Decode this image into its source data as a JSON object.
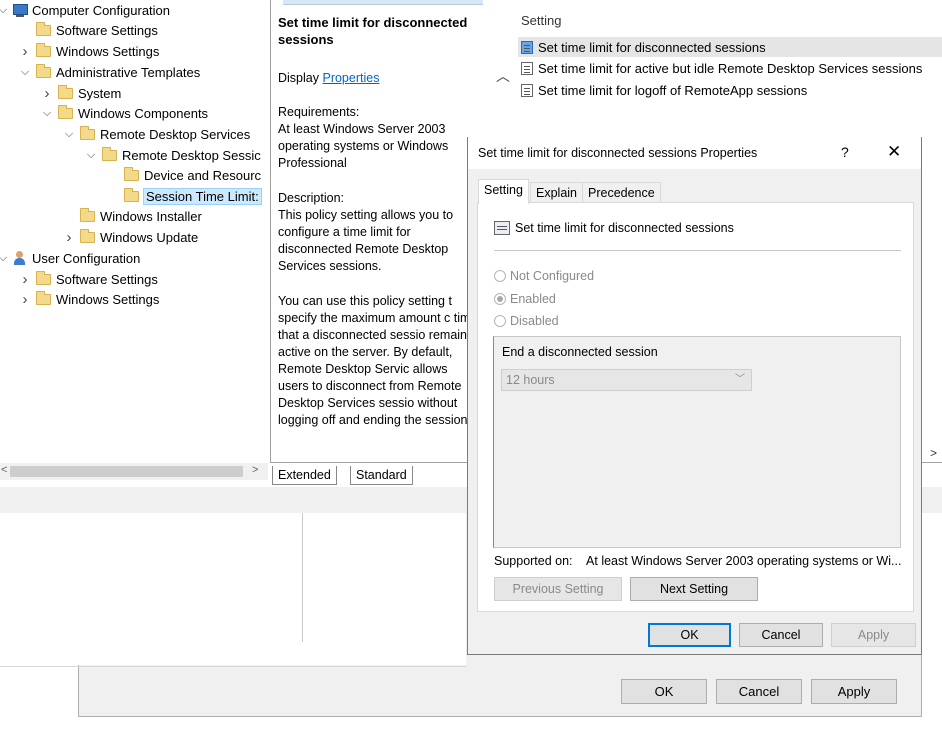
{
  "tree": {
    "items": [
      {
        "label": "Computer Configuration",
        "icon": "computer-icon",
        "chevron": "expanded"
      },
      {
        "label": "Software Settings",
        "icon": "folder-icon",
        "chevron": ""
      },
      {
        "label": "Windows Settings",
        "icon": "folder-icon",
        "chevron": "collapsed"
      },
      {
        "label": "Administrative Templates",
        "icon": "folder-icon",
        "chevron": "expanded"
      },
      {
        "label": "System",
        "icon": "folder-icon",
        "chevron": "collapsed"
      },
      {
        "label": "Windows Components",
        "icon": "folder-icon",
        "chevron": "expanded"
      },
      {
        "label": "Remote Desktop Services",
        "icon": "folder-icon",
        "chevron": "expanded"
      },
      {
        "label": "Remote Desktop Sessic",
        "icon": "folder-icon",
        "chevron": "expanded"
      },
      {
        "label": "Device and Resourc",
        "icon": "folder-icon",
        "chevron": ""
      },
      {
        "label": "Session Time Limit:",
        "icon": "folder-icon",
        "chevron": "",
        "selected": true
      },
      {
        "label": "Windows Installer",
        "icon": "folder-icon",
        "chevron": ""
      },
      {
        "label": "Windows Update",
        "icon": "folder-icon",
        "chevron": "collapsed"
      },
      {
        "label": "User Configuration",
        "icon": "user-icon",
        "chevron": "expanded"
      },
      {
        "label": "Software Settings",
        "icon": "folder-icon",
        "chevron": "collapsed"
      },
      {
        "label": "Windows Settings",
        "icon": "folder-icon",
        "chevron": "collapsed"
      }
    ]
  },
  "description": {
    "title": "Set time limit for disconnected sessions",
    "display_prefix": "Display",
    "display_link": "Properties",
    "requirements_label": "Requirements:",
    "requirements_text": "At least Windows Server 2003 operating systems or Windows Professional",
    "description_label": "Description:",
    "description_p1": "This policy setting allows you to configure a time limit for disconnected Remote Desktop Services sessions.",
    "description_p2": "You can use this policy setting t specify the maximum amount c time that a disconnected sessio remains active on the server. By default, Remote Desktop Servic allows users to disconnect from Remote Desktop Services sessio without logging off and ending the session."
  },
  "bottom_tabs": {
    "extended": "Extended",
    "standard": "Standard"
  },
  "settings_list": {
    "header": "Setting",
    "rows": [
      {
        "label": "Set time limit for disconnected sessions",
        "selected": true
      },
      {
        "label": "Set time limit for active but idle Remote Desktop Services sessions",
        "selected": false
      },
      {
        "label": "Set time limit for logoff of RemoteApp sessions",
        "selected": false
      }
    ]
  },
  "properties_dialog": {
    "title": "Set time limit for disconnected sessions Properties",
    "help_glyph": "?",
    "close_glyph": "✕",
    "tabs": [
      "Setting",
      "Explain",
      "Precedence"
    ],
    "active_tab": "Setting",
    "policy_name": "Set time limit for disconnected sessions",
    "radios": [
      {
        "label": "Not Configured",
        "checked": false
      },
      {
        "label": "Enabled",
        "checked": true
      },
      {
        "label": "Disabled",
        "checked": false
      }
    ],
    "option_label": "End a disconnected session",
    "option_value": "12 hours",
    "supported_label": "Supported on:",
    "supported_value": "At least Windows Server 2003 operating systems or Wi...",
    "prev_button": "Previous Setting",
    "next_button": "Next Setting",
    "ok": "OK",
    "cancel": "Cancel",
    "apply": "Apply"
  },
  "outer_dialog": {
    "ok": "OK",
    "cancel": "Cancel",
    "apply": "Apply"
  },
  "colors": {
    "selection": "#cce8ff",
    "link": "#0066cc",
    "default_button_border": "#0078d7"
  }
}
